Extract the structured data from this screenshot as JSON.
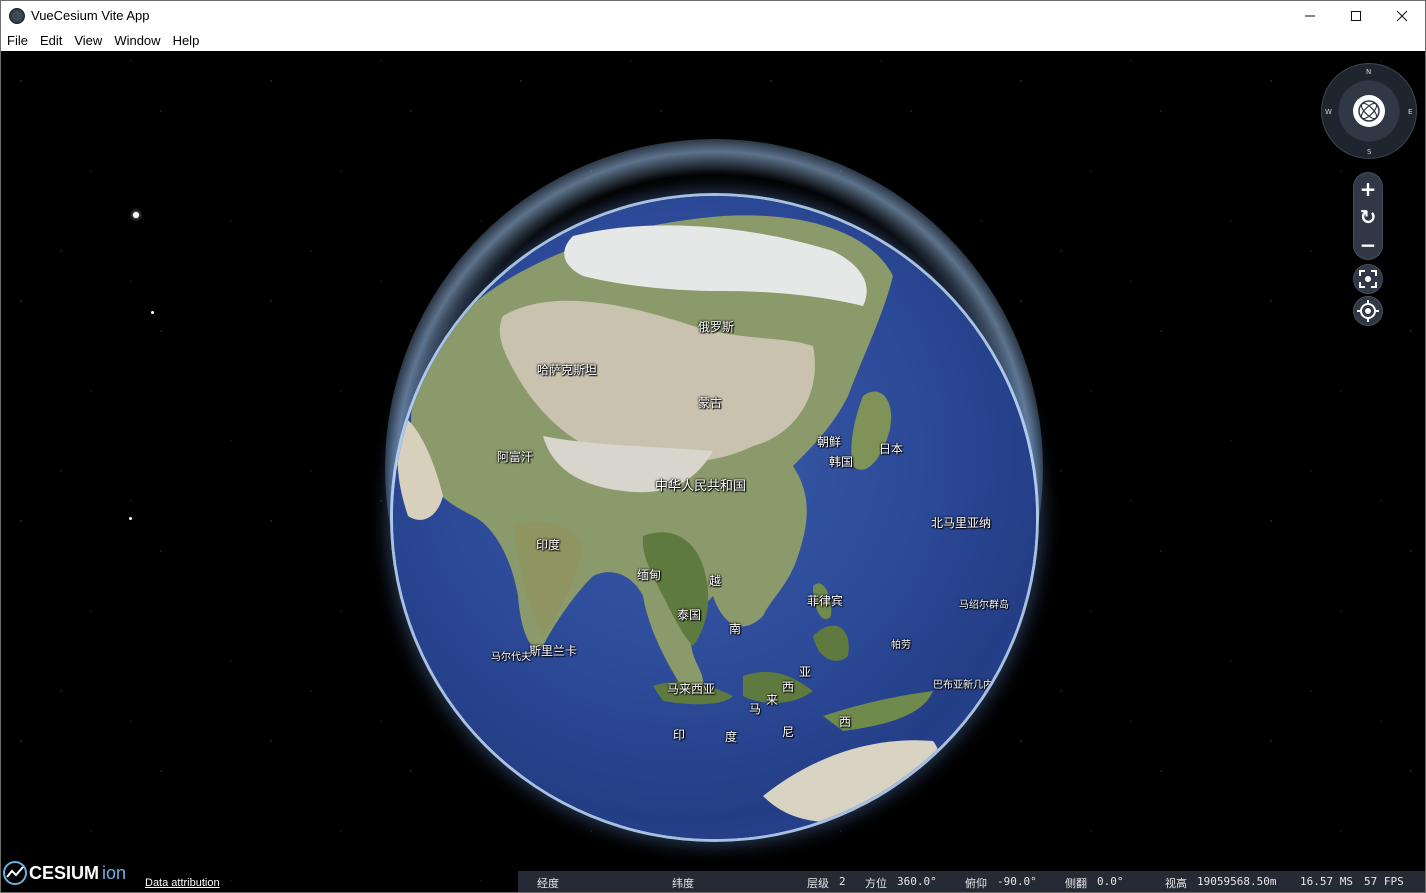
{
  "window": {
    "title": "VueCesium Vite App"
  },
  "window_controls": {
    "minimize": "—",
    "maximize": "☐",
    "close": "✕"
  },
  "menu": [
    "File",
    "Edit",
    "View",
    "Window",
    "Help"
  ],
  "map_labels": {
    "russia": "俄罗斯",
    "mongolia": "蒙古",
    "china": "中华人民共和国",
    "north_korea": "朝鲜",
    "south_korea": "韩国",
    "japan": "日本",
    "kazakhstan": "哈萨克斯坦",
    "afghanistan": "阿富汗",
    "india": "印度",
    "myanmar": "缅甸",
    "thailand": "泰国",
    "vietnam_1": "越",
    "vietnam_2": "南",
    "philippines": "菲律宾",
    "sri_lanka": "斯里兰卡",
    "maldives": "马尔代夫",
    "malaysia": "马来西亚",
    "indonesia_1": "印",
    "indonesia_2": "度",
    "indonesia_3": "尼",
    "indonesia_4": "西",
    "indonesia_5": "亚",
    "malaysia_2": "马",
    "malaysia_3": "来",
    "malaysia_4": "西",
    "northern_mariana": "北马里亚纳",
    "palau": "帕劳",
    "marshall": "马绍尔群岛",
    "papua": "巴布亚新几内亚"
  },
  "compass": {
    "n": "N",
    "e": "E",
    "s": "S",
    "w": "W"
  },
  "navigation": {
    "zoom_in": "+",
    "reset": "↻",
    "zoom_out": "−"
  },
  "branding": {
    "cesium": "CESIUM",
    "ion": "ion",
    "attribution": "Data attribution"
  },
  "status": {
    "longitude_label": "经度",
    "latitude_label": "纬度",
    "level_label": "层级",
    "level_value": "2",
    "heading_label": "方位",
    "heading_value": "360.0°",
    "pitch_label": "俯仰",
    "pitch_value": "-90.0°",
    "roll_label": "侧翻",
    "roll_value": "0.0°",
    "height_label": "视高",
    "height_value": "19059568.50m",
    "ms_value": "16.57 MS",
    "fps_value": "57 FPS"
  },
  "colors": {
    "ocean": "#2c4a98",
    "panel": "#303846",
    "accent_ion": "#6db0e0"
  }
}
